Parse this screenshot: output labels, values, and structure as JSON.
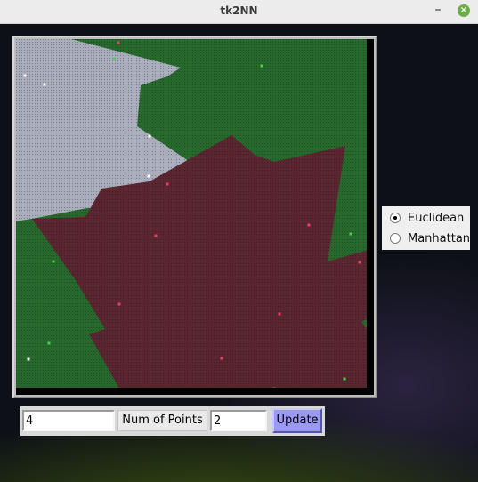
{
  "window": {
    "title": "tk2NN",
    "minimize_glyph": "–",
    "close_glyph": "×"
  },
  "metric": {
    "options": [
      "Euclidean",
      "Manhattan"
    ],
    "selected": "Euclidean"
  },
  "controls": {
    "first_value": "4",
    "num_points_label": "Num of Points",
    "num_points_value": "2",
    "update_label": "Update"
  },
  "colors": {
    "region_gray": "#a9adbc",
    "region_green": "#27692c",
    "region_maroon": "#5a2630",
    "point_gray": "#ffffff",
    "point_green": "#44d04a",
    "point_maroon": "#f23a6a",
    "update_button": "#9a9af5"
  }
}
